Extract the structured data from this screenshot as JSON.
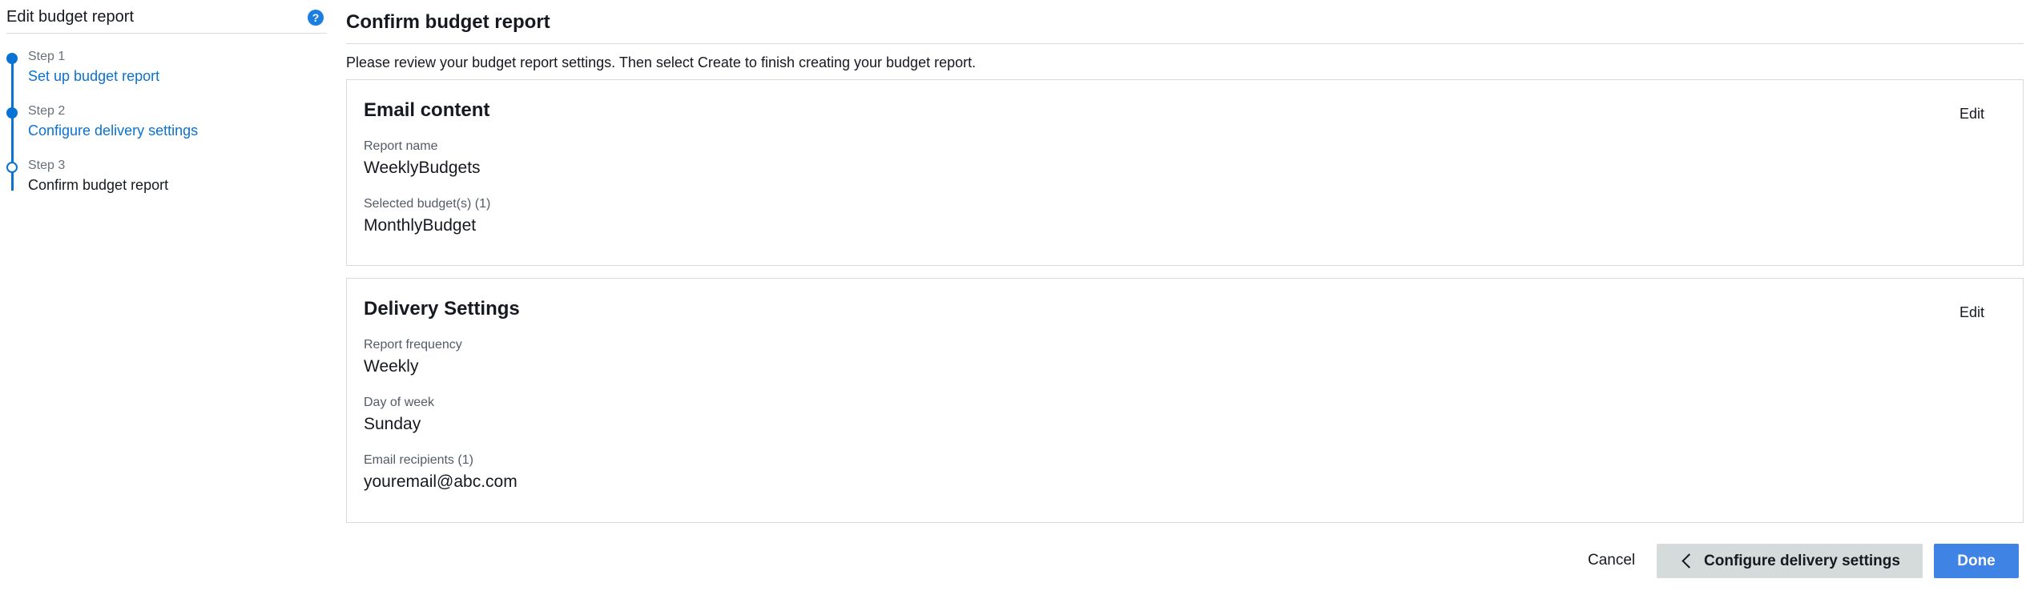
{
  "sidebar": {
    "title": "Edit budget report",
    "help_icon": "question-circle-icon",
    "steps": [
      {
        "number": "Step 1",
        "label": "Set up budget report",
        "state": "completed"
      },
      {
        "number": "Step 2",
        "label": "Configure delivery settings",
        "state": "completed"
      },
      {
        "number": "Step 3",
        "label": "Confirm budget report",
        "state": "current"
      }
    ]
  },
  "main": {
    "title": "Confirm budget report",
    "intro": "Please review your budget report settings. Then select Create to finish creating your budget report.",
    "email_content": {
      "title": "Email content",
      "edit_label": "Edit",
      "fields": [
        {
          "label": "Report name",
          "value": "WeeklyBudgets"
        },
        {
          "label": "Selected budget(s) (1)",
          "value": "MonthlyBudget"
        }
      ]
    },
    "delivery_settings": {
      "title": "Delivery Settings",
      "edit_label": "Edit",
      "fields": [
        {
          "label": "Report frequency",
          "value": "Weekly"
        },
        {
          "label": "Day of week",
          "value": "Sunday"
        },
        {
          "label": "Email recipients (1)",
          "value": "youremail@abc.com"
        }
      ]
    }
  },
  "footer": {
    "cancel_label": "Cancel",
    "back_label": "Configure delivery settings",
    "back_icon": "chevron-left-icon",
    "done_label": "Done"
  },
  "colors": {
    "accent": "#0972d3",
    "primary_button": "#3f84e5",
    "secondary_button": "#d5dbdb",
    "border": "#d5dbdb"
  }
}
